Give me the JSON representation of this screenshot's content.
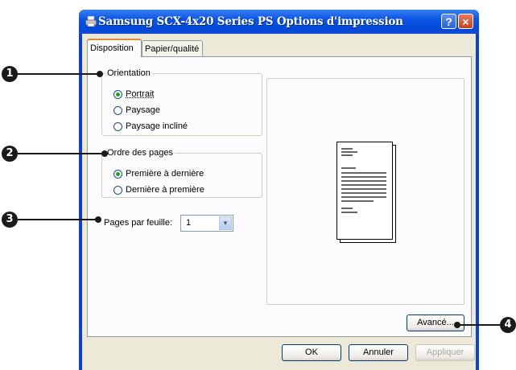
{
  "window": {
    "title": "Samsung SCX-4x20 Series PS Options d'impression",
    "help_label": "?",
    "close_label": "×"
  },
  "tabs": [
    {
      "label": "Disposition",
      "active": true
    },
    {
      "label": "Papier/qualité",
      "active": false
    }
  ],
  "orientation": {
    "legend": "Orientation",
    "options": [
      {
        "label": "Portrait",
        "checked": true
      },
      {
        "label": "Paysage",
        "checked": false
      },
      {
        "label": "Paysage incliné",
        "checked": false
      }
    ]
  },
  "page_order": {
    "legend": "Ordre des pages",
    "options": [
      {
        "label": "Première à dernière",
        "checked": true
      },
      {
        "label": "Dernière à première",
        "checked": false
      }
    ]
  },
  "pages_per_sheet": {
    "label": "Pages par feuille:",
    "value": "1"
  },
  "buttons": {
    "advanced": "Avancé...",
    "ok": "OK",
    "cancel": "Annuler",
    "apply": "Appliquer"
  },
  "callouts": [
    "1",
    "2",
    "3",
    "4"
  ]
}
